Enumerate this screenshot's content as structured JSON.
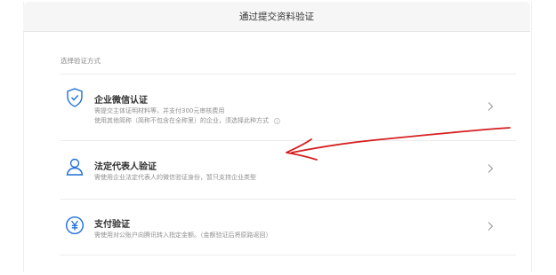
{
  "header": {
    "title": "通过提交资料验证"
  },
  "section_label": "选择验证方式",
  "options": [
    {
      "title": "企业微信认证",
      "desc_line1": "需提交主体证明材料等，并支付300元审核费用",
      "desc_line2": "使用其他简称（简称不包含在全称里）的企业，须选择此种方式",
      "icon": "shield-check-icon"
    },
    {
      "title": "法定代表人验证",
      "desc_line1": "需使用企业法定代表人的微信验证身份，暂只支持企业类型",
      "icon": "person-icon"
    },
    {
      "title": "支付验证",
      "desc_line1": "需使用对公账户向腾讯转入指定金额。（金额验证后将原路返回）",
      "icon": "yuan-icon"
    }
  ],
  "colors": {
    "icon": "#1e6fd9",
    "annotation": "#d61f1f"
  }
}
